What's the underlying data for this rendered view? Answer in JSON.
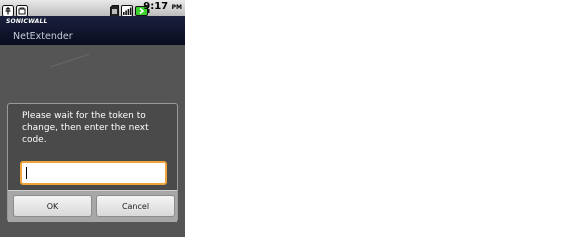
{
  "status_bar": {
    "time": "9:17",
    "ampm": "PM",
    "icons": [
      "usb-icon",
      "debug-icon",
      "sd-card-icon",
      "signal-icon",
      "battery-icon"
    ]
  },
  "app": {
    "brand": "SONICWALL",
    "title": "NetExtender"
  },
  "dialog": {
    "message": "Please wait for the token to change, then enter the next code.",
    "input_value": "",
    "ok_label": "OK",
    "cancel_label": "Cancel"
  },
  "colors": {
    "title_bar": "#0a0d20",
    "dialog_bg": "#4a4a4a",
    "input_focus_border": "#f0a43c",
    "button_bar": "#a7a7a7"
  }
}
